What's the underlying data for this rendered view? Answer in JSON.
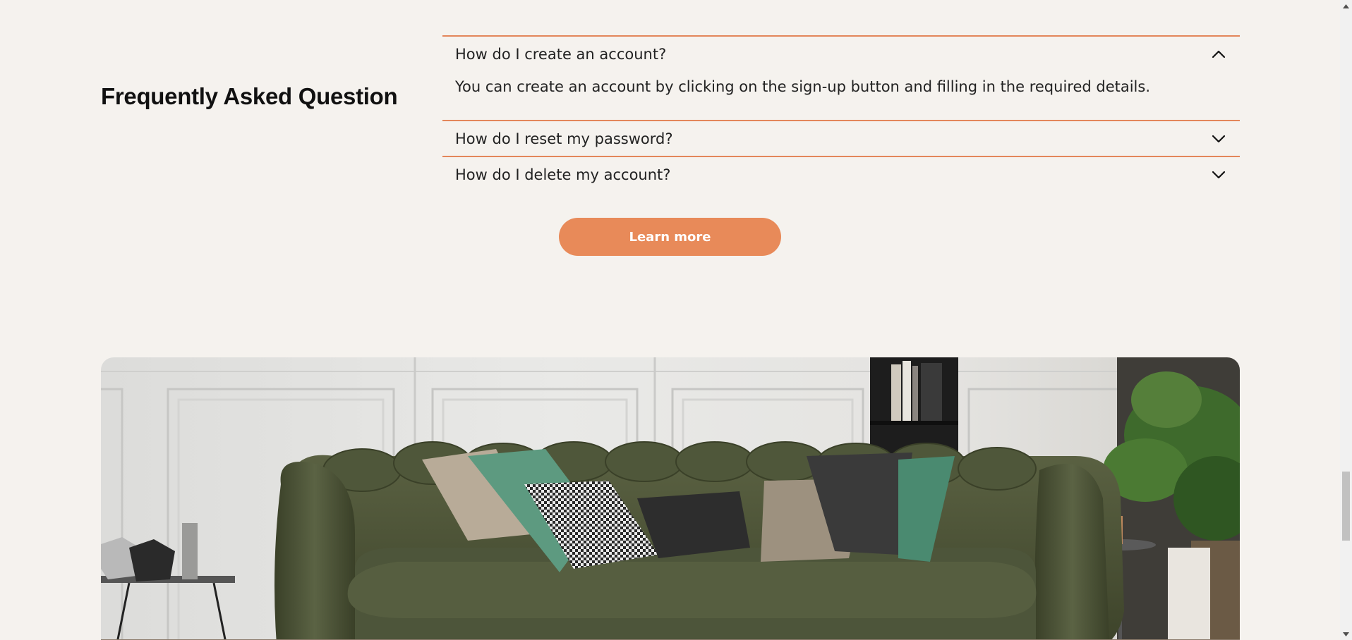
{
  "faq": {
    "title": "Frequently Asked Question",
    "items": [
      {
        "question": "How do I create an account?",
        "answer": "You can create an account by clicking on the sign-up button and filling in the required details.",
        "expanded": true
      },
      {
        "question": "How do I reset my password?",
        "expanded": false
      },
      {
        "question": "How do I delete my account?",
        "expanded": false
      }
    ],
    "learn_more_label": "Learn more"
  },
  "colors": {
    "background": "#f5f2ee",
    "accent": "#e88a59",
    "divider": "#e3865a",
    "sofa": "#4a5234"
  },
  "icons": {
    "expanded": "chevron-up-icon",
    "collapsed": "chevron-down-icon"
  }
}
